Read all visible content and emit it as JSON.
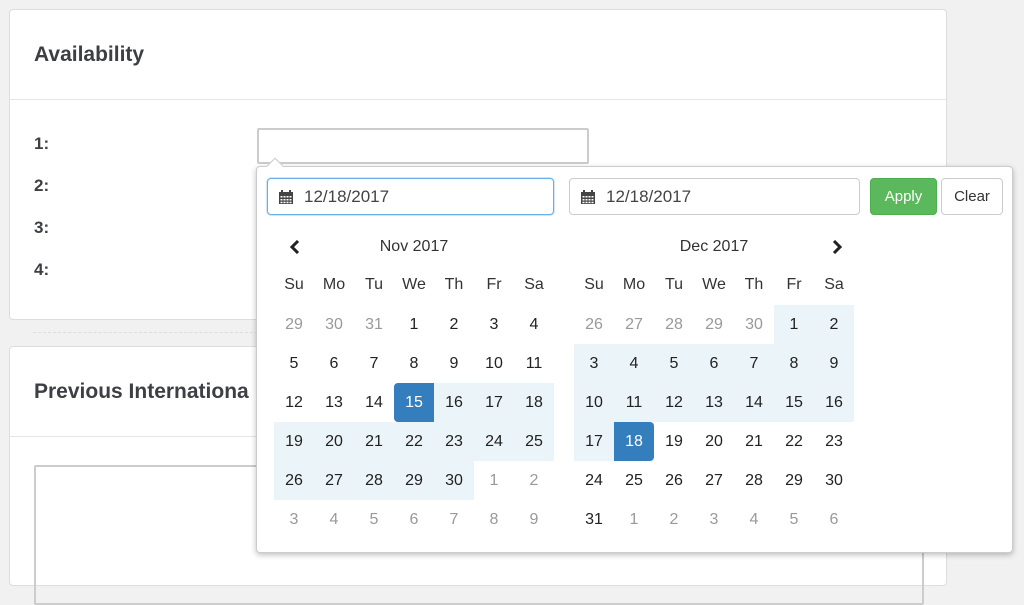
{
  "availability": {
    "title": "Availability",
    "rows": [
      {
        "label": "1:",
        "value": ""
      },
      {
        "label": "2:"
      },
      {
        "label": "3:"
      },
      {
        "label": "4:"
      }
    ]
  },
  "previous": {
    "title": "Previous Internationa"
  },
  "picker": {
    "start_input": {
      "icon": "calendar-icon",
      "value": "12/18/2017"
    },
    "end_input": {
      "icon": "calendar-icon",
      "value": "12/18/2017"
    },
    "apply_label": "Apply",
    "clear_label": "Clear",
    "colors": {
      "apply": "#5cb85c",
      "active": "#357ebd",
      "range": "#ebf4f8",
      "focus": "#66afe9"
    },
    "dow": [
      "Su",
      "Mo",
      "Tu",
      "We",
      "Th",
      "Fr",
      "Sa"
    ],
    "calendars": [
      {
        "title": "Nov 2017",
        "nav": "prev",
        "weeks": [
          [
            {
              "d": "29",
              "s": "off"
            },
            {
              "d": "30",
              "s": "off"
            },
            {
              "d": "31",
              "s": "off"
            },
            {
              "d": "1"
            },
            {
              "d": "2"
            },
            {
              "d": "3"
            },
            {
              "d": "4"
            }
          ],
          [
            {
              "d": "5"
            },
            {
              "d": "6"
            },
            {
              "d": "7"
            },
            {
              "d": "8"
            },
            {
              "d": "9"
            },
            {
              "d": "10"
            },
            {
              "d": "11"
            }
          ],
          [
            {
              "d": "12"
            },
            {
              "d": "13"
            },
            {
              "d": "14"
            },
            {
              "d": "15",
              "s": "active start"
            },
            {
              "d": "16",
              "s": "in-range"
            },
            {
              "d": "17",
              "s": "in-range"
            },
            {
              "d": "18",
              "s": "in-range"
            }
          ],
          [
            {
              "d": "19",
              "s": "in-range"
            },
            {
              "d": "20",
              "s": "in-range"
            },
            {
              "d": "21",
              "s": "in-range"
            },
            {
              "d": "22",
              "s": "in-range"
            },
            {
              "d": "23",
              "s": "in-range"
            },
            {
              "d": "24",
              "s": "in-range"
            },
            {
              "d": "25",
              "s": "in-range"
            }
          ],
          [
            {
              "d": "26",
              "s": "in-range"
            },
            {
              "d": "27",
              "s": "in-range"
            },
            {
              "d": "28",
              "s": "in-range"
            },
            {
              "d": "29",
              "s": "in-range"
            },
            {
              "d": "30",
              "s": "in-range"
            },
            {
              "d": "1",
              "s": "off"
            },
            {
              "d": "2",
              "s": "off"
            }
          ],
          [
            {
              "d": "3",
              "s": "off"
            },
            {
              "d": "4",
              "s": "off"
            },
            {
              "d": "5",
              "s": "off"
            },
            {
              "d": "6",
              "s": "off"
            },
            {
              "d": "7",
              "s": "off"
            },
            {
              "d": "8",
              "s": "off"
            },
            {
              "d": "9",
              "s": "off"
            }
          ]
        ]
      },
      {
        "title": "Dec 2017",
        "nav": "next",
        "weeks": [
          [
            {
              "d": "26",
              "s": "off"
            },
            {
              "d": "27",
              "s": "off"
            },
            {
              "d": "28",
              "s": "off"
            },
            {
              "d": "29",
              "s": "off"
            },
            {
              "d": "30",
              "s": "off"
            },
            {
              "d": "1",
              "s": "in-range"
            },
            {
              "d": "2",
              "s": "in-range"
            }
          ],
          [
            {
              "d": "3",
              "s": "in-range"
            },
            {
              "d": "4",
              "s": "in-range"
            },
            {
              "d": "5",
              "s": "in-range"
            },
            {
              "d": "6",
              "s": "in-range"
            },
            {
              "d": "7",
              "s": "in-range"
            },
            {
              "d": "8",
              "s": "in-range"
            },
            {
              "d": "9",
              "s": "in-range"
            }
          ],
          [
            {
              "d": "10",
              "s": "in-range"
            },
            {
              "d": "11",
              "s": "in-range"
            },
            {
              "d": "12",
              "s": "in-range"
            },
            {
              "d": "13",
              "s": "in-range"
            },
            {
              "d": "14",
              "s": "in-range"
            },
            {
              "d": "15",
              "s": "in-range"
            },
            {
              "d": "16",
              "s": "in-range"
            }
          ],
          [
            {
              "d": "17",
              "s": "in-range"
            },
            {
              "d": "18",
              "s": "active end"
            },
            {
              "d": "19"
            },
            {
              "d": "20"
            },
            {
              "d": "21"
            },
            {
              "d": "22"
            },
            {
              "d": "23"
            }
          ],
          [
            {
              "d": "24"
            },
            {
              "d": "25"
            },
            {
              "d": "26"
            },
            {
              "d": "27"
            },
            {
              "d": "28"
            },
            {
              "d": "29"
            },
            {
              "d": "30"
            }
          ],
          [
            {
              "d": "31"
            },
            {
              "d": "1",
              "s": "off"
            },
            {
              "d": "2",
              "s": "off"
            },
            {
              "d": "3",
              "s": "off"
            },
            {
              "d": "4",
              "s": "off"
            },
            {
              "d": "5",
              "s": "off"
            },
            {
              "d": "6",
              "s": "off"
            }
          ]
        ]
      }
    ]
  }
}
